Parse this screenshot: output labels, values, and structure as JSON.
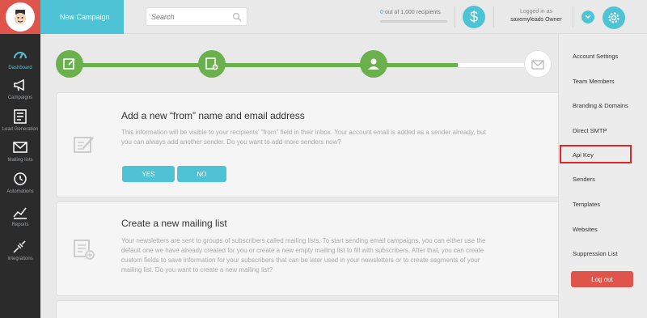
{
  "sidebar": {
    "items": [
      {
        "label": "Dashboard",
        "icon": "gauge-icon"
      },
      {
        "label": "Campaigns",
        "icon": "megaphone-icon"
      },
      {
        "label": "Lead Generation",
        "icon": "form-icon"
      },
      {
        "label": "Mailing lists",
        "icon": "envelope-icon"
      },
      {
        "label": "Automations",
        "icon": "clock-icon"
      },
      {
        "label": "Reports",
        "icon": "chart-icon"
      },
      {
        "label": "Integrations",
        "icon": "plug-icon"
      }
    ]
  },
  "header": {
    "new_campaign": "New Campaign",
    "search_placeholder": "Search",
    "recipients_count": "0",
    "recipients_text": " out of 1,000 recipients",
    "recipients_fraction": 0,
    "dollar": "$",
    "logged_in_as": "Logged in as",
    "user": "savemyleads Owner"
  },
  "cards": [
    {
      "title": "Add a new “from” name and email address",
      "text": "This information will be visible to your recipients' \"from\" field in their inbox. Your account email is added as a sender already, but you can always add another sender. Do you want to add more senders now?",
      "yes": "YES",
      "no": "NO"
    },
    {
      "title": "Create a new mailing list",
      "text": "Your newsletters are sent to groups of subscribers called mailing lists. To start sending email campaigns, you can either use the default one we have already created for you or create a new empty mailing list to fill with subscribers. After that, you can create custom fields to save information for your subscribers that can be later used in your newsletters or to create segments of your mailing list. Do you want to create a new mailing list?"
    }
  ],
  "menu": {
    "items": [
      "Account Settings",
      "Team Members",
      "Branding & Domains",
      "Direct SMTP",
      "Api Key",
      "Senders",
      "Templates",
      "Websites",
      "Suppression List"
    ],
    "logout": "Log out"
  },
  "colors": {
    "accent": "#4fc3d6",
    "success": "#6ab04c",
    "danger": "#e0554b",
    "highlight": "#e0262b"
  }
}
